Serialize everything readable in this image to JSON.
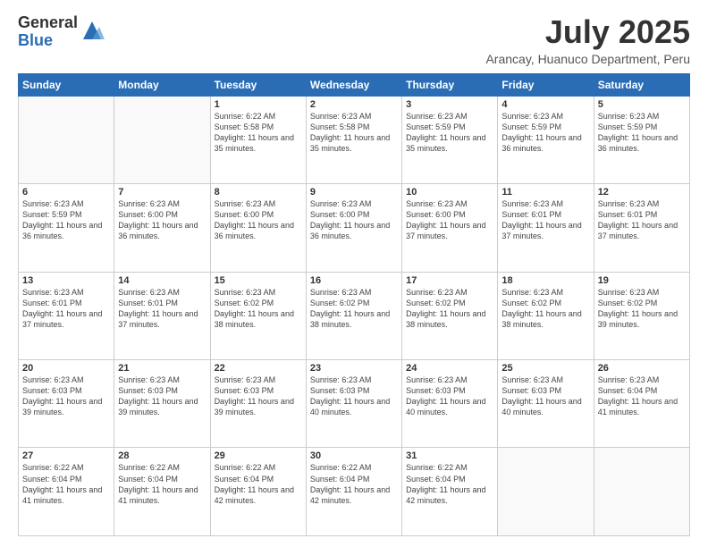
{
  "logo": {
    "general": "General",
    "blue": "Blue"
  },
  "title": "July 2025",
  "subtitle": "Arancay, Huanuco Department, Peru",
  "days_of_week": [
    "Sunday",
    "Monday",
    "Tuesday",
    "Wednesday",
    "Thursday",
    "Friday",
    "Saturday"
  ],
  "weeks": [
    [
      {
        "day": "",
        "info": ""
      },
      {
        "day": "",
        "info": ""
      },
      {
        "day": "1",
        "info": "Sunrise: 6:22 AM\nSunset: 5:58 PM\nDaylight: 11 hours and 35 minutes."
      },
      {
        "day": "2",
        "info": "Sunrise: 6:23 AM\nSunset: 5:58 PM\nDaylight: 11 hours and 35 minutes."
      },
      {
        "day": "3",
        "info": "Sunrise: 6:23 AM\nSunset: 5:59 PM\nDaylight: 11 hours and 35 minutes."
      },
      {
        "day": "4",
        "info": "Sunrise: 6:23 AM\nSunset: 5:59 PM\nDaylight: 11 hours and 36 minutes."
      },
      {
        "day": "5",
        "info": "Sunrise: 6:23 AM\nSunset: 5:59 PM\nDaylight: 11 hours and 36 minutes."
      }
    ],
    [
      {
        "day": "6",
        "info": "Sunrise: 6:23 AM\nSunset: 5:59 PM\nDaylight: 11 hours and 36 minutes."
      },
      {
        "day": "7",
        "info": "Sunrise: 6:23 AM\nSunset: 6:00 PM\nDaylight: 11 hours and 36 minutes."
      },
      {
        "day": "8",
        "info": "Sunrise: 6:23 AM\nSunset: 6:00 PM\nDaylight: 11 hours and 36 minutes."
      },
      {
        "day": "9",
        "info": "Sunrise: 6:23 AM\nSunset: 6:00 PM\nDaylight: 11 hours and 36 minutes."
      },
      {
        "day": "10",
        "info": "Sunrise: 6:23 AM\nSunset: 6:00 PM\nDaylight: 11 hours and 37 minutes."
      },
      {
        "day": "11",
        "info": "Sunrise: 6:23 AM\nSunset: 6:01 PM\nDaylight: 11 hours and 37 minutes."
      },
      {
        "day": "12",
        "info": "Sunrise: 6:23 AM\nSunset: 6:01 PM\nDaylight: 11 hours and 37 minutes."
      }
    ],
    [
      {
        "day": "13",
        "info": "Sunrise: 6:23 AM\nSunset: 6:01 PM\nDaylight: 11 hours and 37 minutes."
      },
      {
        "day": "14",
        "info": "Sunrise: 6:23 AM\nSunset: 6:01 PM\nDaylight: 11 hours and 37 minutes."
      },
      {
        "day": "15",
        "info": "Sunrise: 6:23 AM\nSunset: 6:02 PM\nDaylight: 11 hours and 38 minutes."
      },
      {
        "day": "16",
        "info": "Sunrise: 6:23 AM\nSunset: 6:02 PM\nDaylight: 11 hours and 38 minutes."
      },
      {
        "day": "17",
        "info": "Sunrise: 6:23 AM\nSunset: 6:02 PM\nDaylight: 11 hours and 38 minutes."
      },
      {
        "day": "18",
        "info": "Sunrise: 6:23 AM\nSunset: 6:02 PM\nDaylight: 11 hours and 38 minutes."
      },
      {
        "day": "19",
        "info": "Sunrise: 6:23 AM\nSunset: 6:02 PM\nDaylight: 11 hours and 39 minutes."
      }
    ],
    [
      {
        "day": "20",
        "info": "Sunrise: 6:23 AM\nSunset: 6:03 PM\nDaylight: 11 hours and 39 minutes."
      },
      {
        "day": "21",
        "info": "Sunrise: 6:23 AM\nSunset: 6:03 PM\nDaylight: 11 hours and 39 minutes."
      },
      {
        "day": "22",
        "info": "Sunrise: 6:23 AM\nSunset: 6:03 PM\nDaylight: 11 hours and 39 minutes."
      },
      {
        "day": "23",
        "info": "Sunrise: 6:23 AM\nSunset: 6:03 PM\nDaylight: 11 hours and 40 minutes."
      },
      {
        "day": "24",
        "info": "Sunrise: 6:23 AM\nSunset: 6:03 PM\nDaylight: 11 hours and 40 minutes."
      },
      {
        "day": "25",
        "info": "Sunrise: 6:23 AM\nSunset: 6:03 PM\nDaylight: 11 hours and 40 minutes."
      },
      {
        "day": "26",
        "info": "Sunrise: 6:23 AM\nSunset: 6:04 PM\nDaylight: 11 hours and 41 minutes."
      }
    ],
    [
      {
        "day": "27",
        "info": "Sunrise: 6:22 AM\nSunset: 6:04 PM\nDaylight: 11 hours and 41 minutes."
      },
      {
        "day": "28",
        "info": "Sunrise: 6:22 AM\nSunset: 6:04 PM\nDaylight: 11 hours and 41 minutes."
      },
      {
        "day": "29",
        "info": "Sunrise: 6:22 AM\nSunset: 6:04 PM\nDaylight: 11 hours and 42 minutes."
      },
      {
        "day": "30",
        "info": "Sunrise: 6:22 AM\nSunset: 6:04 PM\nDaylight: 11 hours and 42 minutes."
      },
      {
        "day": "31",
        "info": "Sunrise: 6:22 AM\nSunset: 6:04 PM\nDaylight: 11 hours and 42 minutes."
      },
      {
        "day": "",
        "info": ""
      },
      {
        "day": "",
        "info": ""
      }
    ]
  ]
}
